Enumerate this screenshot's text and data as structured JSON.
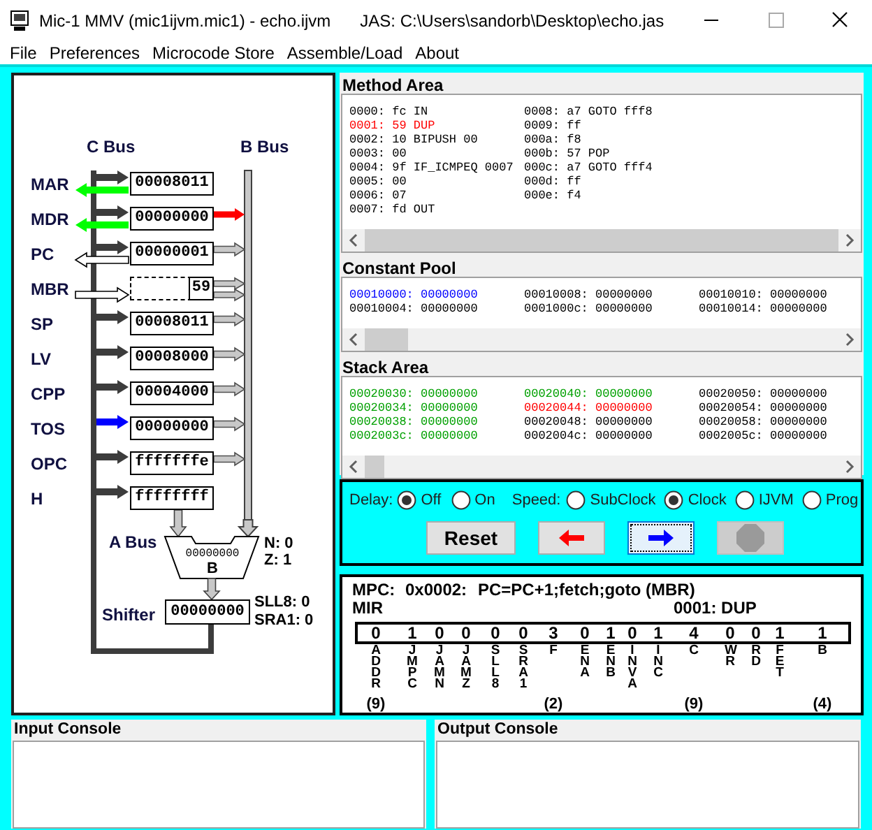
{
  "window": {
    "title": "Mic-1 MMV (mic1ijvm.mic1) - echo.ijvm",
    "subtitle": "JAS: C:\\Users\\sandorb\\Desktop\\echo.jas"
  },
  "menu": [
    "File",
    "Preferences",
    "Microcode Store",
    "Assemble/Load",
    "About"
  ],
  "datapath": {
    "c_bus_label": "C Bus",
    "b_bus_label": "B Bus",
    "a_bus_label": "A Bus",
    "registers": [
      {
        "name": "MAR",
        "value": "00008011",
        "kind": "word",
        "arrows": [
          {
            "kind": "c_input",
            "active": false
          },
          {
            "kind": "memory_out",
            "active": true
          }
        ]
      },
      {
        "name": "MDR",
        "value": "00000000",
        "kind": "word",
        "arrows": [
          {
            "kind": "c_input",
            "active": false
          },
          {
            "kind": "b_output",
            "active": true
          },
          {
            "kind": "memory_out",
            "active": true
          }
        ]
      },
      {
        "name": "PC",
        "value": "00000001",
        "kind": "word",
        "arrows": [
          {
            "kind": "c_input",
            "active": false
          },
          {
            "kind": "b_output",
            "active": false
          },
          {
            "kind": "memory_out",
            "active": false
          }
        ]
      },
      {
        "name": "MBR",
        "value": "59",
        "kind": "byte",
        "arrows": [
          {
            "kind": "b_output",
            "active": false
          },
          {
            "kind": "memory_in",
            "active": false
          }
        ]
      },
      {
        "name": "SP",
        "value": "00008011",
        "kind": "word",
        "arrows": [
          {
            "kind": "c_input",
            "active": false
          },
          {
            "kind": "b_output",
            "active": false
          }
        ]
      },
      {
        "name": "LV",
        "value": "00008000",
        "kind": "word",
        "arrows": [
          {
            "kind": "c_input",
            "active": false
          },
          {
            "kind": "b_output",
            "active": false
          }
        ]
      },
      {
        "name": "CPP",
        "value": "00004000",
        "kind": "word",
        "arrows": [
          {
            "kind": "c_input",
            "active": false
          },
          {
            "kind": "b_output",
            "active": false
          }
        ]
      },
      {
        "name": "TOS",
        "value": "00000000",
        "kind": "word",
        "arrows": [
          {
            "kind": "c_input",
            "active": true
          },
          {
            "kind": "b_output",
            "active": false
          }
        ]
      },
      {
        "name": "OPC",
        "value": "fffffffe",
        "kind": "word",
        "arrows": [
          {
            "kind": "c_input",
            "active": false
          },
          {
            "kind": "b_output",
            "active": false
          }
        ]
      },
      {
        "name": "H",
        "value": "ffffffff",
        "kind": "word",
        "arrows": [
          {
            "kind": "c_input",
            "active": false
          }
        ]
      }
    ],
    "alu": {
      "value": "00000000",
      "label": "B",
      "flags": [
        "N: 0",
        "Z: 1"
      ]
    },
    "shifter": {
      "label": "Shifter",
      "value": "00000000",
      "flags": [
        "SLL8: 0",
        "SRA1: 0"
      ]
    }
  },
  "method_area": {
    "title": "Method Area",
    "entries": [
      {
        "text": "0000: fc IN",
        "selected": false
      },
      {
        "text": "0001: 59 DUP",
        "selected": true
      },
      {
        "text": "0002: 10 BIPUSH 00",
        "selected": false
      },
      {
        "text": "0003: 00",
        "selected": false
      },
      {
        "text": "0004: 9f IF_ICMPEQ 0007",
        "selected": false
      },
      {
        "text": "0005: 00",
        "selected": false
      },
      {
        "text": "0006: 07",
        "selected": false
      },
      {
        "text": "0007: fd OUT",
        "selected": false
      },
      {
        "text": "0008: a7 GOTO fff8",
        "selected": false
      },
      {
        "text": "0009: ff",
        "selected": false
      },
      {
        "text": "000a: f8",
        "selected": false
      },
      {
        "text": "000b: 57 POP",
        "selected": false
      },
      {
        "text": "000c: a7 GOTO fff4",
        "selected": false
      },
      {
        "text": "000d: ff",
        "selected": false
      },
      {
        "text": "000e: f4",
        "selected": false
      }
    ]
  },
  "constant_pool": {
    "title": "Constant Pool",
    "entries": [
      {
        "text": "00010000: 00000000",
        "color": "#0000ff"
      },
      {
        "text": "00010004: 00000000",
        "color": "#000000"
      },
      {
        "text": "00010008: 00000000",
        "color": "#000000"
      },
      {
        "text": "0001000c: 00000000",
        "color": "#000000"
      },
      {
        "text": "00010010: 00000000",
        "color": "#000000"
      },
      {
        "text": "00010014: 00000000",
        "color": "#000000"
      }
    ]
  },
  "stack_area": {
    "title": "Stack Area",
    "entries": [
      {
        "text": "00020030: 00000000",
        "color": "#00a000"
      },
      {
        "text": "00020034: 00000000",
        "color": "#00a000"
      },
      {
        "text": "00020038: 00000000",
        "color": "#00a000"
      },
      {
        "text": "0002003c: 00000000",
        "color": "#00a000"
      },
      {
        "text": "00020040: 00000000",
        "color": "#00a000"
      },
      {
        "text": "00020044: 00000000",
        "color": "#ff0000"
      },
      {
        "text": "00020048: 00000000",
        "color": "#000000"
      },
      {
        "text": "0002004c: 00000000",
        "color": "#000000"
      },
      {
        "text": "00020050: 00000000",
        "color": "#000000"
      },
      {
        "text": "00020054: 00000000",
        "color": "#000000"
      },
      {
        "text": "00020058: 00000000",
        "color": "#000000"
      },
      {
        "text": "0002005c: 00000000",
        "color": "#000000"
      }
    ]
  },
  "controls": {
    "delay": {
      "label": "Delay:",
      "options": [
        {
          "label": "Off",
          "selected": true
        },
        {
          "label": "On",
          "selected": false
        }
      ]
    },
    "speed": {
      "label": "Speed:",
      "options": [
        {
          "label": "SubClock",
          "selected": false
        },
        {
          "label": "Clock",
          "selected": true
        },
        {
          "label": "IJVM",
          "selected": false
        },
        {
          "label": "Prog",
          "selected": false
        }
      ]
    },
    "buttons": [
      {
        "kind": "text",
        "label": "Reset",
        "focused": false,
        "disabled": false
      },
      {
        "kind": "back",
        "focused": false,
        "disabled": false
      },
      {
        "kind": "forward",
        "focused": true,
        "disabled": false
      },
      {
        "kind": "stop",
        "focused": false,
        "disabled": true
      }
    ]
  },
  "mir": {
    "mpc_label": "MPC:",
    "mpc_address": "0x0002:",
    "microinstruction": "PC=PC+1;fetch;goto (MBR)",
    "mir_label": "MIR",
    "instruction": "0001: DUP",
    "fields": [
      {
        "value": "0",
        "label": "ADDR",
        "width": "(9)"
      },
      {
        "value": "1",
        "label": "JMPC"
      },
      {
        "value": "0",
        "label": "JAMN"
      },
      {
        "value": "0",
        "label": "JAMZ"
      },
      {
        "value": "0",
        "label": "SLL8"
      },
      {
        "value": "0",
        "label": "SRA1"
      },
      {
        "value": "3",
        "label": "F",
        "width": "(2)"
      },
      {
        "value": "0",
        "label": "ENA"
      },
      {
        "value": "1",
        "label": "ENB"
      },
      {
        "value": "0",
        "label": "INVA"
      },
      {
        "value": "1",
        "label": "INC"
      },
      {
        "value": "4",
        "label": "C",
        "width": "(9)"
      },
      {
        "value": "0",
        "label": "WR"
      },
      {
        "value": "0",
        "label": "RD"
      },
      {
        "value": "1",
        "label": "FET"
      },
      {
        "value": "1",
        "label": "B",
        "width": "(4)"
      }
    ]
  },
  "consoles": [
    {
      "title": "Input Console"
    },
    {
      "title": "Output Console"
    }
  ]
}
